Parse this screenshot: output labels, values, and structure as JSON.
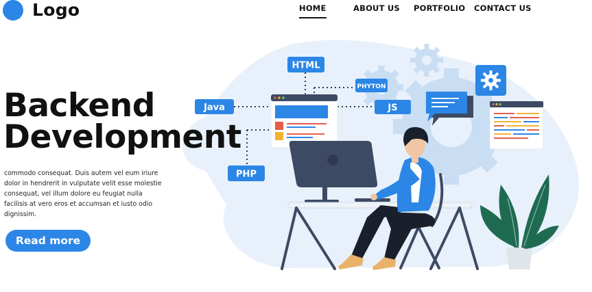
{
  "header": {
    "logo_text": "Logo",
    "nav": [
      {
        "label": "HOME",
        "active": true
      },
      {
        "label": "ABOUT US",
        "active": false
      },
      {
        "label": "PORTFOLIO",
        "active": false
      },
      {
        "label": "CONTACT US",
        "active": false
      }
    ]
  },
  "hero": {
    "title_line1": "Backend",
    "title_line2": "Development",
    "description": "commodo consequat. Duis autem vel eum iriure dolor in hendrerit in vulputate velit esse molestie consequat, vel illum dolore eu feugiat nulla facilisis at vero eros et accumsan et iusto odio dignissim.",
    "button_label": "Read more"
  },
  "illustration": {
    "tags": {
      "html": "HTML",
      "phyton": "PHYTON",
      "java": "Java",
      "js": "JS",
      "php": "PHP"
    }
  },
  "colors": {
    "accent": "#2b86e6",
    "text": "#111111",
    "blob": "#e8f1fb",
    "gear": "#c9ddf3",
    "monitor": "#3d4a63",
    "leaf": "#1f6b52"
  }
}
